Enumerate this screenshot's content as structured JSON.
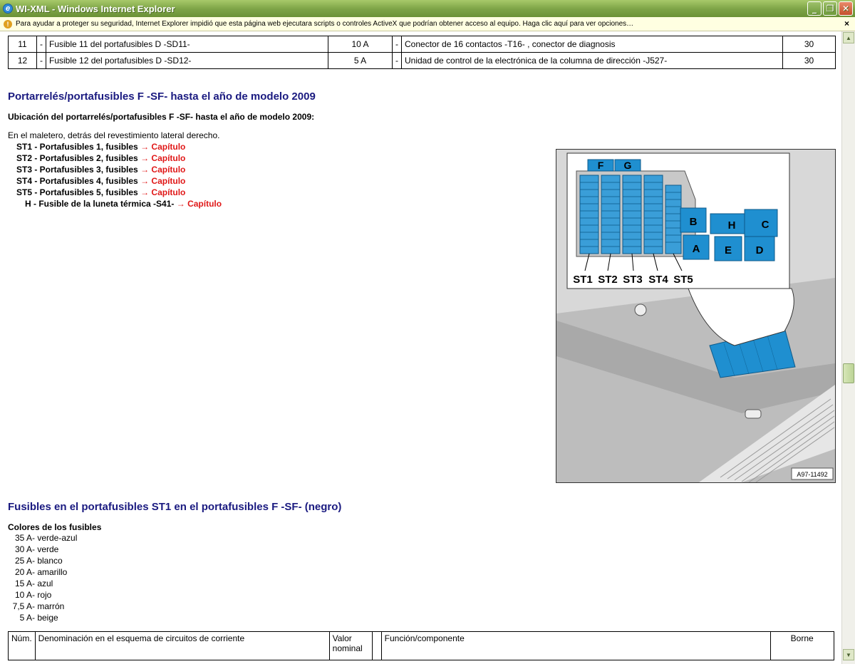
{
  "window": {
    "title": "WI-XML - Windows Internet Explorer",
    "controls": {
      "minimize": "_",
      "maximize": "❐",
      "close": "✕"
    }
  },
  "infobar": {
    "message": "Para ayudar a proteger su seguridad, Internet Explorer impidió que esta página web ejecutara scripts o controles ActiveX que podrían obtener acceso al equipo. Haga clic aquí para ver opciones…",
    "close": "×"
  },
  "top_table": {
    "rows": [
      {
        "num": "11",
        "dash1": "-",
        "name": "Fusible 11 del portafusibles D -SD11-",
        "amp": "10 A",
        "dash2": "-",
        "func": "Conector de 16 contactos -T16- , conector de diagnosis",
        "borne": "30"
      },
      {
        "num": "12",
        "dash1": "-",
        "name": "Fusible 12 del portafusibles D -SD12-",
        "amp": "5 A",
        "dash2": "-",
        "func": "Unidad de control de la electrónica de la columna de dirección -J527-",
        "borne": "30"
      }
    ]
  },
  "section1": {
    "heading": "Portarrelés/portafusibles F -SF- hasta el año de modelo 2009",
    "subheading": "Ubicación del portarrelés/portafusibles F -SF- hasta el año de modelo 2009:",
    "location_text": "En el maletero, detrás del revestimiento lateral derecho.",
    "items": [
      {
        "code": "ST1",
        "text": " - Portafusibles 1, fusibles ",
        "link": "→ Capítulo"
      },
      {
        "code": "ST2",
        "text": " - Portafusibles 2, fusibles ",
        "link": "→ Capítulo"
      },
      {
        "code": "ST3",
        "text": " - Portafusibles 3, fusibles ",
        "link": "→ Capítulo"
      },
      {
        "code": "ST4",
        "text": " - Portafusibles 4, fusibles ",
        "link": "→ Capítulo"
      },
      {
        "code": "ST5",
        "text": " - Portafusibles 5, fusibles ",
        "link": "→ Capítulo"
      },
      {
        "code": "H",
        "text": " - Fusible de la luneta térmica -S41- ",
        "link": "→ Capítulo"
      }
    ]
  },
  "figure": {
    "labels": {
      "F": "F",
      "G": "G",
      "A": "A",
      "B": "B",
      "C": "C",
      "D": "D",
      "E": "E",
      "H": "H",
      "ST1": "ST1",
      "ST2": "ST2",
      "ST3": "ST3",
      "ST4": "ST4",
      "ST5": "ST5"
    },
    "reference": "A97-11492",
    "colors": {
      "relay_blue": "#1f8fd0",
      "fuse_blue": "#3a9ed8"
    }
  },
  "section2": {
    "heading": "Fusibles en el portafusibles ST1 en el portafusibles F -SF- (negro)",
    "colors_title": "Colores de los fusibles",
    "colors": [
      {
        "amp": "35 A",
        "color": " - verde-azul"
      },
      {
        "amp": "30 A",
        "color": " - verde"
      },
      {
        "amp": "25 A",
        "color": " - blanco"
      },
      {
        "amp": "20 A",
        "color": " - amarillo"
      },
      {
        "amp": "15 A",
        "color": " - azul"
      },
      {
        "amp": "10 A",
        "color": " - rojo"
      },
      {
        "amp": "7,5 A",
        "color": " - marrón"
      },
      {
        "amp": "5 A",
        "color": " - beige"
      }
    ]
  },
  "table_header": {
    "num": "Núm.",
    "name": "Denominación en el esquema de circuitos de corriente",
    "valor": "Valor nominal",
    "func": "Función/componente",
    "borne": "Borne"
  }
}
